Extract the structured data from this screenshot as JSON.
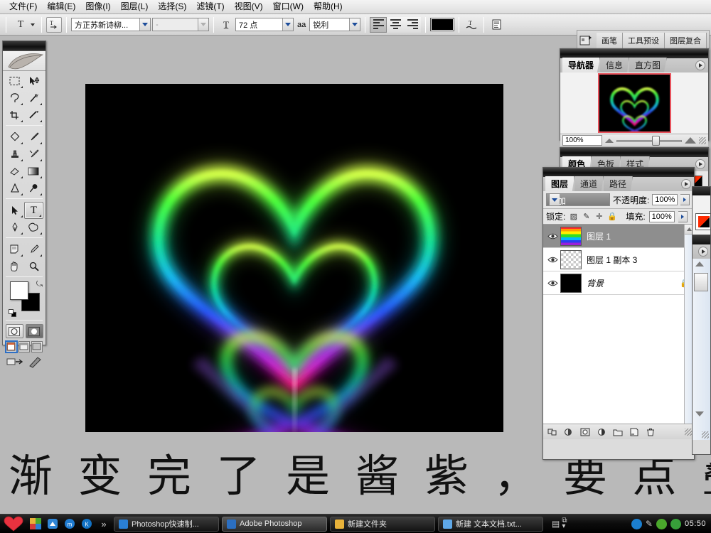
{
  "menubar": {
    "items": [
      {
        "label": "文件(F)"
      },
      {
        "label": "编辑(E)"
      },
      {
        "label": "图像(I)"
      },
      {
        "label": "图层(L)"
      },
      {
        "label": "选择(S)"
      },
      {
        "label": "滤镜(T)"
      },
      {
        "label": "视图(V)"
      },
      {
        "label": "窗口(W)"
      },
      {
        "label": "帮助(H)"
      }
    ]
  },
  "options_bar": {
    "tool_glyph": "T",
    "orientation_icon": "text-orientation-icon",
    "font_family": "方正苏新诗柳...",
    "font_style": "-",
    "font_size": "72 点",
    "antialias_label": "aa",
    "antialias_value": "锐利",
    "align_left": "align-left-icon",
    "align_center": "align-center-icon",
    "align_right": "align-right-icon",
    "text_color": "#000000",
    "warp_icon": "warp-text-icon",
    "palette_icon": "character-paragraph-icon",
    "bridge_icon": "go-to-bridge-icon"
  },
  "dock": {
    "tabs": [
      {
        "label": "画笔"
      },
      {
        "label": "工具预设"
      },
      {
        "label": "图层复合"
      }
    ]
  },
  "toolbox": {
    "tools": [
      {
        "name": "marquee-tool",
        "glyph": "▭"
      },
      {
        "name": "move-tool",
        "glyph": "➤"
      },
      {
        "name": "lasso-tool",
        "glyph": "◯"
      },
      {
        "name": "magic-wand-tool",
        "glyph": "✸"
      },
      {
        "name": "crop-tool",
        "glyph": "⌗"
      },
      {
        "name": "slice-tool",
        "glyph": "✂"
      },
      {
        "name": "healing-brush-tool",
        "glyph": "◇"
      },
      {
        "name": "brush-tool",
        "glyph": "✎"
      },
      {
        "name": "clone-stamp-tool",
        "glyph": "♣"
      },
      {
        "name": "history-brush-tool",
        "glyph": "✐"
      },
      {
        "name": "eraser-tool",
        "glyph": "▱"
      },
      {
        "name": "gradient-tool",
        "glyph": "▤"
      },
      {
        "name": "blur-tool",
        "glyph": "△"
      },
      {
        "name": "dodge-tool",
        "glyph": "●"
      },
      {
        "name": "path-selection-tool",
        "glyph": "➤"
      },
      {
        "name": "type-tool",
        "glyph": "T"
      },
      {
        "name": "pen-tool",
        "glyph": "✒"
      },
      {
        "name": "shape-tool",
        "glyph": "✧"
      },
      {
        "name": "notes-tool",
        "glyph": "▣"
      },
      {
        "name": "eyedropper-tool",
        "glyph": "⌇"
      },
      {
        "name": "hand-tool",
        "glyph": "✋"
      },
      {
        "name": "zoom-tool",
        "glyph": "🔍"
      }
    ],
    "selected_tool": "type-tool",
    "foreground_color": "#ffffff",
    "background_color": "#000000",
    "quickmask_standard": "standard-mode",
    "quickmask_mask": "quick-mask-mode",
    "screen_modes": [
      "standard-screen-mode",
      "full-screen-with-menubar",
      "full-screen-mode"
    ],
    "jump_to_imageready": "jump-to-imageready"
  },
  "navigator": {
    "tabs": [
      {
        "label": "导航器"
      },
      {
        "label": "信息"
      },
      {
        "label": "直方图"
      }
    ],
    "active_tab": "导航器",
    "zoom_value": "100%"
  },
  "color_panel": {
    "tabs": [
      {
        "label": "颜色"
      },
      {
        "label": "色板"
      },
      {
        "label": "样式"
      }
    ],
    "active_tab": "颜色"
  },
  "layers_panel": {
    "tabs": [
      {
        "label": "图层"
      },
      {
        "label": "通道"
      },
      {
        "label": "路径"
      }
    ],
    "active_tab": "图层",
    "blend_mode": "叠加",
    "opacity_label": "不透明度:",
    "opacity_value": "100%",
    "lock_label": "锁定:",
    "fill_label": "填充:",
    "fill_value": "100%",
    "lock_icons": [
      "lock-transparency-icon",
      "lock-image-icon",
      "lock-position-icon",
      "lock-all-icon"
    ],
    "layers": [
      {
        "name": "图层 1",
        "visible": true,
        "selected": true,
        "thumb": "rainbow",
        "locked": false
      },
      {
        "name": "图层 1 副本 3",
        "visible": true,
        "selected": false,
        "thumb": "transparent",
        "locked": false
      },
      {
        "name": "背景",
        "visible": true,
        "selected": false,
        "thumb": "black",
        "locked": true
      }
    ],
    "footer_icons": [
      {
        "name": "link-layers-icon",
        "glyph": "⛓"
      },
      {
        "name": "layer-style-icon",
        "glyph": "●"
      },
      {
        "name": "layer-mask-icon",
        "glyph": "◐"
      },
      {
        "name": "adjustment-layer-icon",
        "glyph": "◑"
      },
      {
        "name": "new-group-icon",
        "glyph": "🗀"
      },
      {
        "name": "new-layer-icon",
        "glyph": "▣"
      },
      {
        "name": "delete-layer-icon",
        "glyph": "🗑"
      }
    ]
  },
  "canvas": {
    "artwork_title": "glowing-rainbow-hearts"
  },
  "caption": {
    "text": "渐 变 完 了 是 酱 紫 ，  要 点 叠 加 呀 。"
  },
  "taskbar": {
    "start_icon": "heart-start-button",
    "quick_launch": [
      {
        "name": "quicklaunch-colorful-icon"
      },
      {
        "name": "quicklaunch-blue-icon"
      },
      {
        "name": "quicklaunch-messenger-icon"
      },
      {
        "name": "quicklaunch-kingsoft-icon"
      },
      {
        "name": "quicklaunch-more-chevron"
      }
    ],
    "tasks": [
      {
        "label": "Photoshop快速制...",
        "active": false,
        "icon_color": "#2a7fd4"
      },
      {
        "label": "Adobe Photoshop",
        "active": true,
        "icon_color": "#2b6fc2"
      },
      {
        "label": "新建文件夹",
        "active": false,
        "icon_color": "#e8b23a"
      },
      {
        "label": "新建 文本文档.txt...",
        "active": false,
        "icon_color": "#5fa8e8"
      }
    ],
    "tray_icons": [
      {
        "name": "tray-kingsoft-icon",
        "color": "#1b7fd0"
      },
      {
        "name": "tray-pen-icon",
        "color": "#c9c9c9"
      },
      {
        "name": "tray-green-cross-icon",
        "color": "#4aa82c"
      },
      {
        "name": "tray-shield-icon",
        "color": "#37a03a"
      }
    ],
    "clock": "05:50"
  }
}
